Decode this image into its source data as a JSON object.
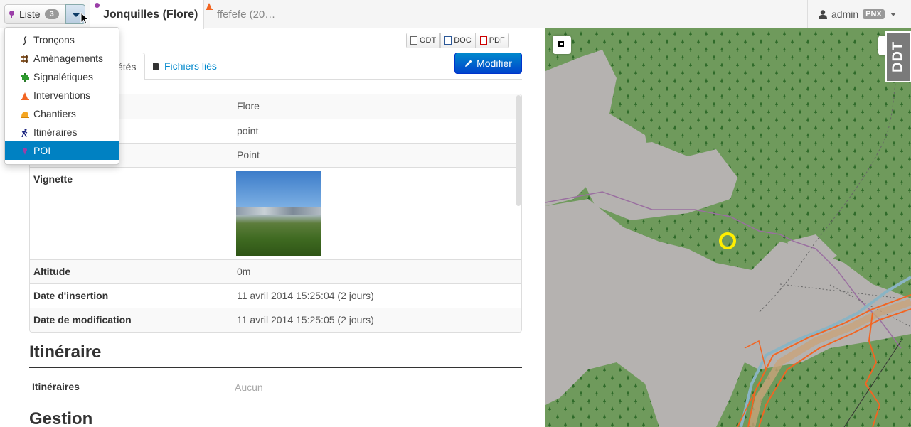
{
  "topbar": {
    "liste_label": "Liste",
    "liste_count": "3",
    "active_tab": "Jonquilles (Flore)",
    "other_tab": "ffefefe (20…",
    "user": "admin",
    "structure": "PNX"
  },
  "dropdown": {
    "items": [
      {
        "label": "Tronçons",
        "icon": "path-icon"
      },
      {
        "label": "Aménagements",
        "icon": "infrastructure-icon"
      },
      {
        "label": "Signalétiques",
        "icon": "signage-icon"
      },
      {
        "label": "Interventions",
        "icon": "intervention-icon"
      },
      {
        "label": "Chantiers",
        "icon": "project-icon"
      },
      {
        "label": "Itinéraires",
        "icon": "trek-icon"
      },
      {
        "label": "POI",
        "icon": "poi-icon"
      }
    ],
    "active": "POI"
  },
  "export": {
    "odt": "ODT",
    "doc": "DOC",
    "pdf": "PDF"
  },
  "modify_label": "Modifier",
  "tabs": {
    "properties": "étés",
    "files": "Fichiers liés"
  },
  "properties": [
    {
      "key": "",
      "value": "Flore"
    },
    {
      "key": "",
      "value": "point"
    },
    {
      "key": "",
      "value": "Point"
    },
    {
      "key": "Vignette",
      "value": ""
    },
    {
      "key": "Altitude",
      "value": "0m"
    },
    {
      "key": "Date d'insertion",
      "value": "11 avril 2014 15:25:04 (2 jours)"
    },
    {
      "key": "Date de modification",
      "value": "11 avril 2014 15:25:05 (2 jours)"
    }
  ],
  "itineraire": {
    "heading": "Itinéraire",
    "label": "Itinéraires",
    "value": "Aucun"
  },
  "gestion": {
    "heading": "Gestion"
  },
  "map": {
    "watermark": "DDT",
    "forest_color": "#6f9a5c",
    "clearing_color": "#b5b2b0",
    "poi_color": "#ffee00",
    "trail_color": "#f26522"
  }
}
